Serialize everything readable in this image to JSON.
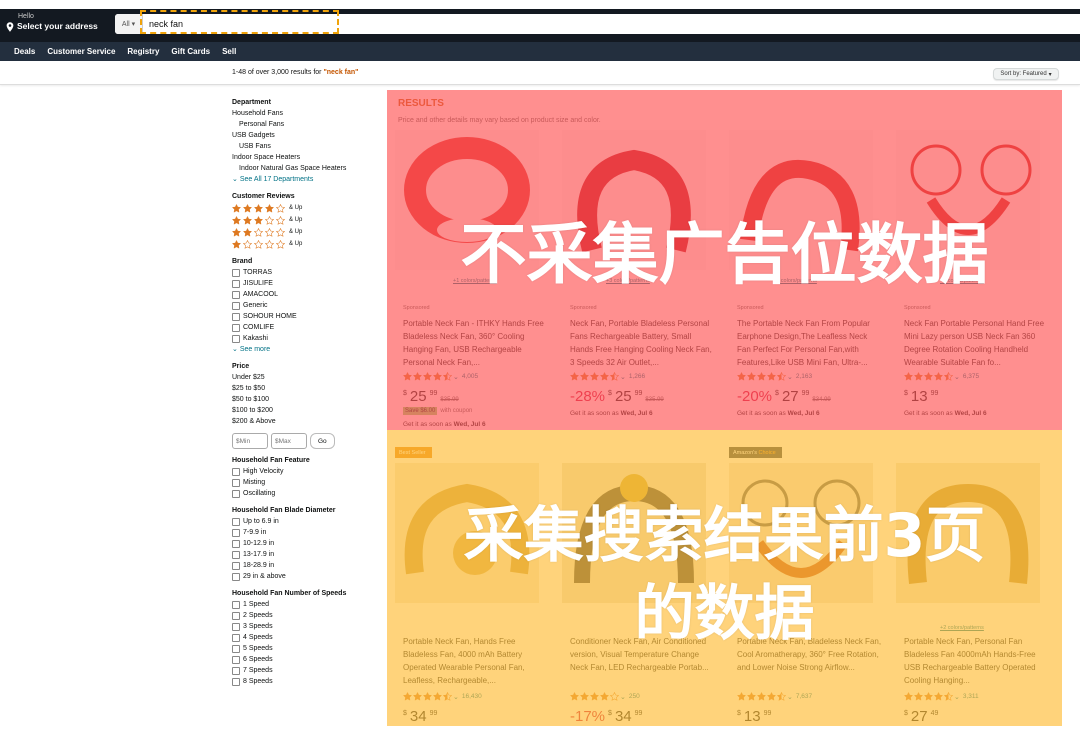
{
  "header": {
    "hello": "Hello",
    "address": "Select your address",
    "category": "All",
    "search_value": "neck fan"
  },
  "nav": [
    "Deals",
    "Customer Service",
    "Registry",
    "Gift Cards",
    "Sell"
  ],
  "results_bar": {
    "count_prefix": "1-48 of over 3,000 results for ",
    "query": "\"neck fan\"",
    "sort": "Sort by: Featured"
  },
  "sidebar": {
    "department_title": "Department",
    "departments": [
      {
        "label": "Household Fans",
        "indent": false
      },
      {
        "label": "Personal Fans",
        "indent": true
      },
      {
        "label": "USB Gadgets",
        "indent": false
      },
      {
        "label": "USB Fans",
        "indent": true
      },
      {
        "label": "Indoor Space Heaters",
        "indent": false
      },
      {
        "label": "Indoor Natural Gas Space Heaters",
        "indent": true
      }
    ],
    "see_all": "See All 17 Departments",
    "reviews_title": "Customer Reviews",
    "review_rows": [
      {
        "stars": 4,
        "label": "& Up"
      },
      {
        "stars": 3,
        "label": "& Up"
      },
      {
        "stars": 2,
        "label": "& Up"
      },
      {
        "stars": 1,
        "label": "& Up"
      }
    ],
    "brand_title": "Brand",
    "brands": [
      "TORRAS",
      "JISULIFE",
      "AMACOOL",
      "Generic",
      "SOHOUR HOME",
      "COMLIFE",
      "Kakashi"
    ],
    "see_more": "See more",
    "price_title": "Price",
    "prices": [
      "Under $25",
      "$25 to $50",
      "$50 to $100",
      "$100 to $200",
      "$200 & Above"
    ],
    "min_placeholder": "$Min",
    "max_placeholder": "$Max",
    "go": "Go",
    "feature_title": "Household Fan Feature",
    "features": [
      "High Velocity",
      "Misting",
      "Oscillating"
    ],
    "diameter_title": "Household Fan Blade Diameter",
    "diameters": [
      "Up to 6.9 in",
      "7-9.9 in",
      "10-12.9 in",
      "13-17.9 in",
      "18-28.9 in",
      "29 in & above"
    ],
    "speeds_title": "Household Fan Number of Speeds",
    "speeds": [
      "1 Speed",
      "2 Speeds",
      "3 Speeds",
      "4 Speeds",
      "5 Speeds",
      "6 Speeds",
      "7 Speeds",
      "8 Speeds"
    ]
  },
  "results": {
    "title": "RESULTS",
    "subtitle": "Price and other details may vary based on product size and color.",
    "row1": [
      {
        "sponsored": "Sponsored",
        "colors": "+1 colors/patterns",
        "title": "Portable Neck Fan - ITHKY Hands Free Bladeless Neck Fan, 360° Cooling Hanging Fan, USB Rechargeable Personal Neck Fan,...",
        "rating": 4.5,
        "reviews": "4,005",
        "price_whole": "25",
        "price_frac": "99",
        "old": "$35.99",
        "discount": "",
        "coupon": "Save $6.00",
        "coupon_text": "with coupon",
        "delivery_prefix": "Get it as soon as ",
        "delivery_date": "Wed, Jul 6"
      },
      {
        "sponsored": "Sponsored",
        "colors": "+3 colors/patterns",
        "title": "Neck Fan, Portable Bladeless Personal Fans Rechargeable Battery, Small Hands Free Hanging Cooling Neck Fan, 3 Speeds 32 Air Outlet,...",
        "rating": 4.5,
        "reviews": "1,266",
        "price_whole": "25",
        "price_frac": "99",
        "old": "$35.99",
        "discount": "-28%",
        "coupon": "",
        "coupon_text": "",
        "delivery_prefix": "Get it as soon as ",
        "delivery_date": "Wed, Jul 6"
      },
      {
        "sponsored": "Sponsored",
        "colors": "+1 colors/patterns",
        "title": "The Portable Neck Fan From Popular Earphone Design,The Leafless Neck Fan Perfect For Personal Fan,with Features,Like USB Mini Fan, Ultra-...",
        "rating": 4.5,
        "reviews": "2,163",
        "price_whole": "27",
        "price_frac": "99",
        "old": "$34.99",
        "discount": "-20%",
        "coupon": "",
        "coupon_text": "",
        "delivery_prefix": "Get it as soon as ",
        "delivery_date": "Wed, Jul 6"
      },
      {
        "sponsored": "Sponsored",
        "colors": "+6 colors/patterns",
        "title": "Neck Fan Portable Personal Hand Free Mini Lazy person USB Neck Fan 360 Degree Rotation Cooling Handheld Wearable Suitable Fan fo...",
        "rating": 4.5,
        "reviews": "6,375",
        "price_whole": "13",
        "price_frac": "99",
        "old": "",
        "discount": "",
        "coupon": "",
        "coupon_text": "",
        "delivery_prefix": "Get it as soon as ",
        "delivery_date": "Wed, Jul 6"
      }
    ],
    "row2": [
      {
        "badge": "Best Seller",
        "title": "Portable Neck Fan, Hands Free Bladeless Fan, 4000 mAh Battery Operated Wearable Personal Fan, Leafless, Rechargeable,...",
        "rating": 4.5,
        "reviews": "16,430",
        "price_whole": "34",
        "price_frac": "99"
      },
      {
        "badge": "",
        "title": "Conditioner Neck Fan, Air Conditioned version, Visual Temperature Change Neck Fan, LED Rechargeable Portab...",
        "rating": 4,
        "reviews": "250",
        "price_whole": "34",
        "price_frac": "99",
        "discount": "-17%"
      },
      {
        "badge_a": "Amazon's",
        "badge_b": "Choice",
        "title": "Portable Neck Fan, Bladeless Neck Fan, Cool Aromatherapy, 360° Free Rotation, and Lower Noise Strong Airflow...",
        "rating": 4.5,
        "reviews": "7,637",
        "price_whole": "13",
        "price_frac": "99"
      },
      {
        "colors": "+2 colors/patterns",
        "title": "Portable Neck Fan, Personal Fan Bladeless Fan 4000mAh Hands-Free USB Rechargeable Battery Operated Cooling Hanging...",
        "rating": 4.5,
        "reviews": "3,311",
        "price_whole": "27",
        "price_frac": "49"
      }
    ]
  },
  "overlay": {
    "red_text": "不采集广告位数据",
    "orange_text_1": "采集搜索结果前3页",
    "orange_text_2": "的数据",
    "red_color": "#ff5a5a",
    "orange_color": "#ffbe3c"
  },
  "colors": {
    "header_bg": "#131921",
    "nav_bg": "#232f3e",
    "link": "#007185",
    "accent": "#c45500",
    "star": "#de7921"
  }
}
